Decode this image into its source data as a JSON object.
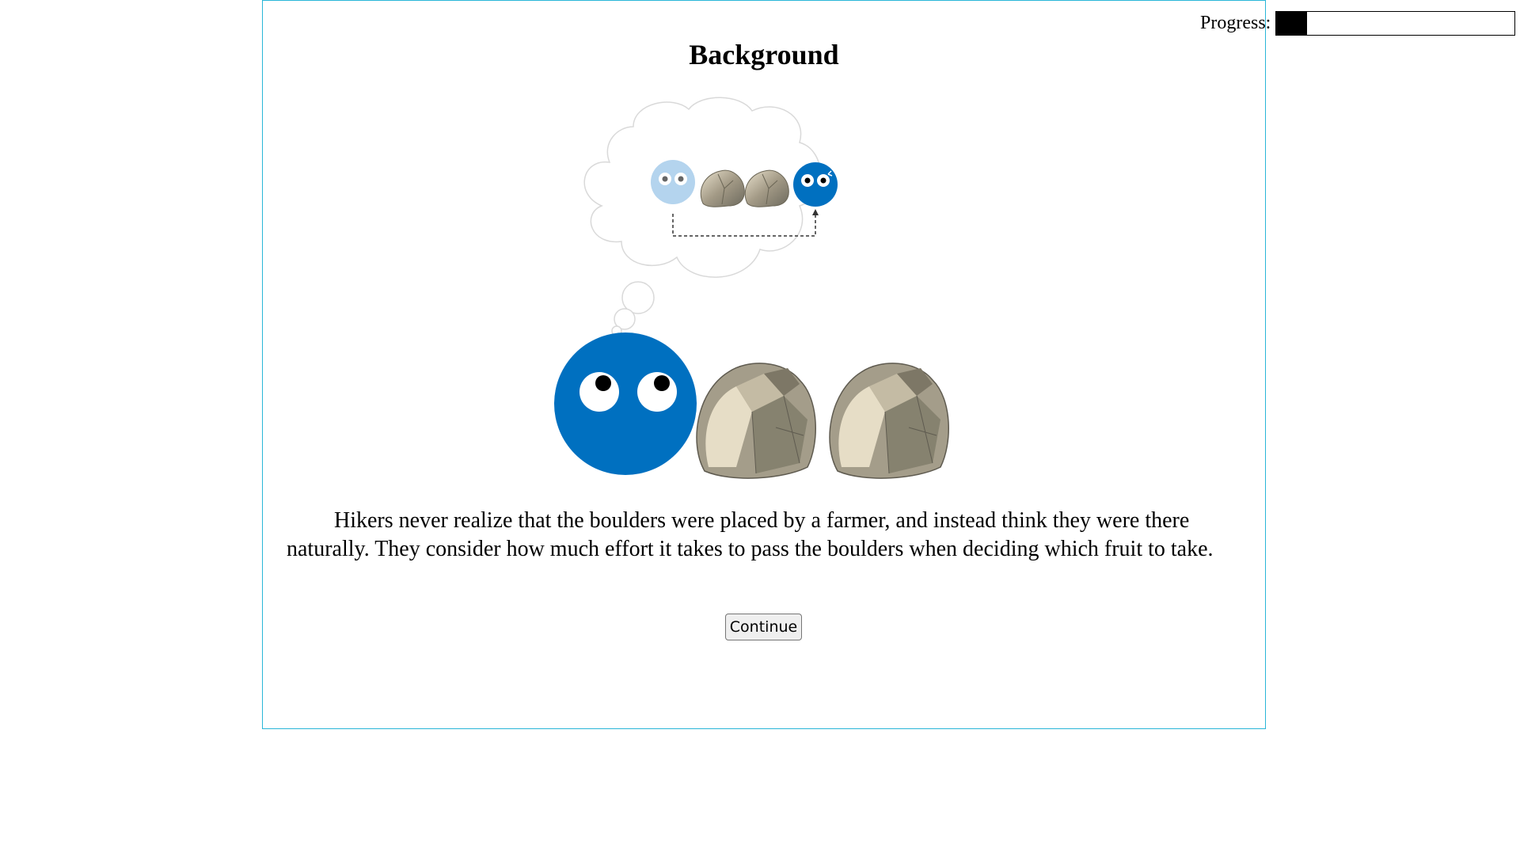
{
  "progress": {
    "label": "Progress:",
    "value": 0.13
  },
  "page": {
    "title": "Background",
    "body": "Hikers never realize that the boulders were placed by a farmer, and instead think they were there naturally. They consider how much effort it takes to pass the boulders when deciding which fruit to take."
  },
  "actions": {
    "continue_label": "Continue"
  },
  "colors": {
    "frame_border": "#29b6d8",
    "hiker_blue": "#0070c0",
    "light_blue": "#b4d4ee"
  },
  "illustration": {
    "icons": [
      "thought-bubble-icon",
      "hiker-icon",
      "boulder-icon",
      "boulder-icon"
    ]
  }
}
